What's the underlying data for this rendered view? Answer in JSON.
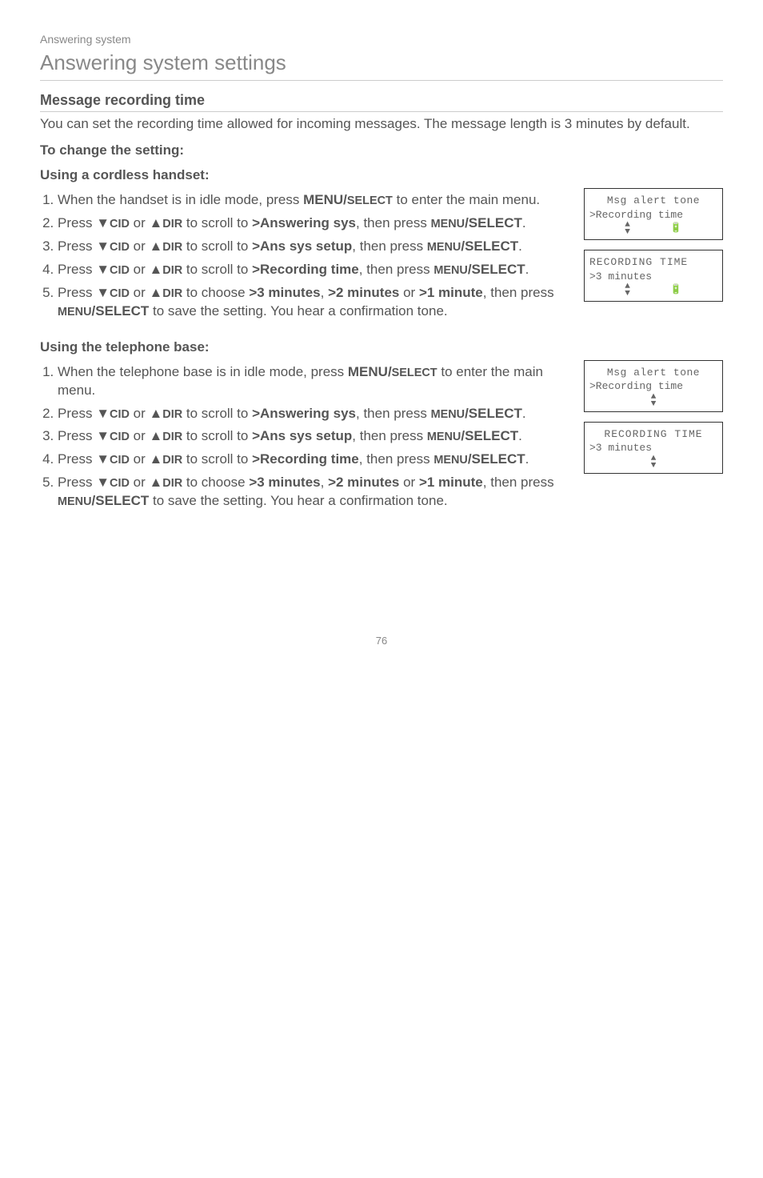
{
  "breadcrumb": "Answering system",
  "page_title": "Answering system settings",
  "section_heading": "Message recording time",
  "intro": "You can set the recording time allowed for incoming messages. The message length is 3 minutes by default.",
  "to_change": "To change the setting:",
  "using_handset": "Using a cordless handset:",
  "handset_steps": {
    "s1a": "When the handset is in idle mode, press ",
    "s1b": "MENU/",
    "s1c": "SELECT",
    "s1d": " to enter the main menu.",
    "s2a": "Press ",
    "down": "▼",
    "cid": "CID",
    "or": " or ",
    "up": "▲",
    "dir": "DIR",
    "s2b": " to scroll to ",
    "answering_sys": ">Answering sys",
    "then_press": ", then press ",
    "menu": "MENU",
    "select": "/SELECT",
    "period": ".",
    "s3b": " to scroll to ",
    "ans_setup": ">Ans sys setup",
    "s4b": " to scroll to ",
    "rec_time": ">Recording time",
    "s4c": ", then press ",
    "s5a": " to choose ",
    "m3": ">3 minutes",
    "comma": ", ",
    "m2": ">2 minutes",
    "s5or": " or ",
    "m1": ">1 minute",
    "s5b": ", then press ",
    "s5c": " to save the setting. You hear a confirmation tone."
  },
  "using_base": "Using the telephone base:",
  "base_steps": {
    "s1a": "When the telephone base is in idle mode, press ",
    "s1b": "MENU/",
    "s1c": "SELECT",
    "s1d": " to enter the main menu."
  },
  "screens": {
    "h1_l1": "Msg alert tone",
    "h1_l2": ">Recording time",
    "h2_l1": "RECORDING TIME",
    "h2_l2": ">3 minutes",
    "b1_l1": "Msg alert tone",
    "b1_l2": ">Recording time",
    "b2_l1": "RECORDING TIME",
    "b2_l2": ">3 minutes"
  },
  "arrow_updown": "▲\n▼",
  "battery": "🔋",
  "page_number": "76"
}
